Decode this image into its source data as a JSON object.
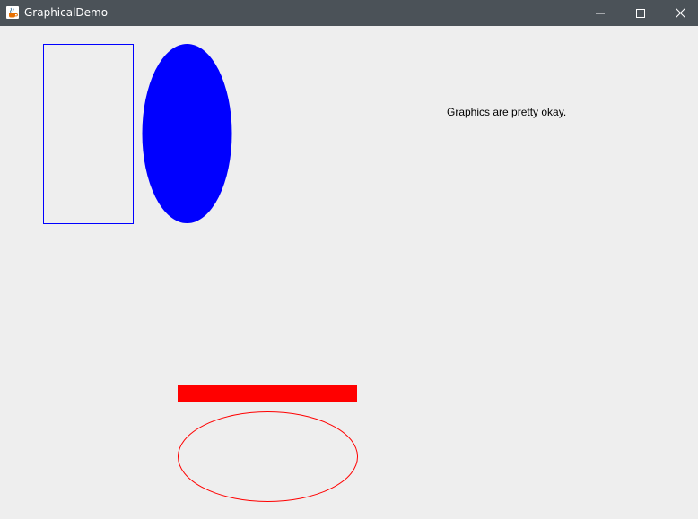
{
  "window": {
    "title": "GraphicalDemo",
    "app_icon": "java-cup-icon",
    "controls": {
      "minimize_icon": "minimize-icon",
      "maximize_icon": "maximize-icon",
      "close_icon": "close-icon"
    }
  },
  "canvas": {
    "caption": "Graphics are pretty okay.",
    "shapes": [
      {
        "name": "outlined-rectangle",
        "kind": "rectangle",
        "style": "outline",
        "color": "#0000ff"
      },
      {
        "name": "filled-ellipse",
        "kind": "ellipse",
        "style": "filled",
        "color": "#0000ff"
      },
      {
        "name": "filled-bar",
        "kind": "rectangle",
        "style": "filled",
        "color": "#ff0000"
      },
      {
        "name": "outlined-ellipse",
        "kind": "ellipse",
        "style": "outline",
        "color": "#ff0000"
      }
    ]
  },
  "colors": {
    "titlebar": "#4b5258",
    "background": "#eeeeee",
    "blue": "#0000ff",
    "red": "#ff0000"
  }
}
